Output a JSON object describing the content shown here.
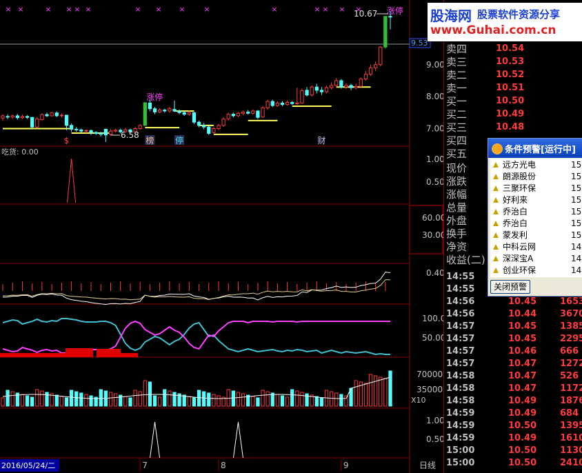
{
  "chart": {
    "candles": [
      {
        "o": 7.33,
        "c": 7.4,
        "h": 7.45,
        "l": 7.25
      },
      {
        "o": 7.38,
        "c": 7.36,
        "h": 7.45,
        "l": 7.3
      },
      {
        "o": 7.36,
        "c": 7.4,
        "h": 7.44,
        "l": 7.3
      },
      {
        "o": 7.4,
        "c": 7.34,
        "h": 7.46,
        "l": 7.28
      },
      {
        "o": 7.34,
        "c": 7.38,
        "h": 7.44,
        "l": 7.3
      },
      {
        "o": 7.38,
        "c": 7.35,
        "h": 7.42,
        "l": 7.3
      },
      {
        "o": 7.35,
        "c": 7.05,
        "h": 7.36,
        "l": 7.0
      },
      {
        "o": 7.05,
        "c": 7.3,
        "h": 7.36,
        "l": 7.02
      },
      {
        "o": 7.28,
        "c": 7.44,
        "h": 7.48,
        "l": 7.26
      },
      {
        "o": 7.44,
        "c": 7.4,
        "h": 7.5,
        "l": 7.36
      },
      {
        "o": 7.4,
        "c": 7.49,
        "h": 7.53,
        "l": 7.38
      },
      {
        "o": 7.49,
        "c": 7.4,
        "h": 7.54,
        "l": 7.36
      },
      {
        "o": 7.4,
        "c": 7.42,
        "h": 7.48,
        "l": 7.34
      },
      {
        "o": 7.42,
        "c": 7.1,
        "h": 7.43,
        "l": 6.95
      },
      {
        "o": 7.1,
        "c": 6.98,
        "h": 7.16,
        "l": 6.9
      },
      {
        "o": 6.98,
        "c": 6.96,
        "h": 7.05,
        "l": 6.9
      },
      {
        "o": 6.96,
        "c": 6.92,
        "h": 7.0,
        "l": 6.86
      },
      {
        "o": 6.92,
        "c": 6.94,
        "h": 6.98,
        "l": 6.86
      },
      {
        "o": 6.94,
        "c": 6.88,
        "h": 6.97,
        "l": 6.8
      },
      {
        "o": 6.88,
        "c": 6.85,
        "h": 6.92,
        "l": 6.8
      },
      {
        "o": 6.86,
        "c": 6.82,
        "h": 6.9,
        "l": 6.75
      },
      {
        "o": 6.98,
        "c": 6.8,
        "h": 7.0,
        "l": 6.58
      },
      {
        "o": 6.82,
        "c": 6.92,
        "h": 6.98,
        "l": 6.78
      },
      {
        "o": 6.92,
        "c": 6.95,
        "h": 7.0,
        "l": 6.88
      },
      {
        "o": 6.95,
        "c": 6.9,
        "h": 7.0,
        "l": 6.85
      },
      {
        "o": 6.9,
        "c": 6.96,
        "h": 7.02,
        "l": 6.88
      },
      {
        "o": 6.96,
        "c": 6.9,
        "h": 7.0,
        "l": 6.86
      },
      {
        "o": 6.9,
        "c": 7.0,
        "h": 7.06,
        "l": 6.88
      },
      {
        "o": 7.0,
        "c": 7.1,
        "h": 7.14,
        "l": 6.96
      },
      {
        "o": 7.1,
        "c": 7.81,
        "h": 7.81,
        "l": 7.08
      },
      {
        "o": 7.8,
        "c": 7.62,
        "h": 7.9,
        "l": 7.55
      },
      {
        "o": 7.62,
        "c": 7.52,
        "h": 7.68,
        "l": 7.45
      },
      {
        "o": 7.52,
        "c": 7.58,
        "h": 7.64,
        "l": 7.48
      },
      {
        "o": 7.58,
        "c": 7.55,
        "h": 7.62,
        "l": 7.5
      },
      {
        "o": 7.55,
        "c": 7.62,
        "h": 7.68,
        "l": 7.5
      },
      {
        "o": 7.6,
        "c": 7.55,
        "h": 7.88,
        "l": 7.52
      },
      {
        "o": 7.55,
        "c": 7.5,
        "h": 7.6,
        "l": 7.45
      },
      {
        "o": 7.5,
        "c": 7.45,
        "h": 7.56,
        "l": 7.4
      },
      {
        "o": 7.45,
        "c": 7.5,
        "h": 7.56,
        "l": 7.4
      },
      {
        "o": 7.5,
        "c": 7.2,
        "h": 7.52,
        "l": 7.14
      },
      {
        "o": 7.2,
        "c": 7.1,
        "h": 7.25,
        "l": 7.04
      },
      {
        "o": 7.1,
        "c": 7.05,
        "h": 7.18,
        "l": 6.98
      },
      {
        "o": 7.05,
        "c": 6.85,
        "h": 7.08,
        "l": 6.8
      },
      {
        "o": 6.88,
        "c": 7.0,
        "h": 7.05,
        "l": 6.84
      },
      {
        "o": 7.0,
        "c": 7.1,
        "h": 7.15,
        "l": 6.95
      },
      {
        "o": 7.1,
        "c": 7.3,
        "h": 7.35,
        "l": 7.05
      },
      {
        "o": 7.3,
        "c": 7.45,
        "h": 7.5,
        "l": 7.25
      },
      {
        "o": 7.45,
        "c": 7.4,
        "h": 7.5,
        "l": 7.35
      },
      {
        "o": 7.4,
        "c": 7.48,
        "h": 7.52,
        "l": 7.36
      },
      {
        "o": 7.48,
        "c": 7.52,
        "h": 7.56,
        "l": 7.42
      },
      {
        "o": 7.52,
        "c": 7.48,
        "h": 7.58,
        "l": 7.44
      },
      {
        "o": 7.48,
        "c": 7.55,
        "h": 7.6,
        "l": 7.44
      },
      {
        "o": 7.55,
        "c": 7.35,
        "h": 7.58,
        "l": 7.3
      },
      {
        "o": 7.36,
        "c": 7.65,
        "h": 7.7,
        "l": 7.34
      },
      {
        "o": 7.65,
        "c": 7.85,
        "h": 7.9,
        "l": 7.6
      },
      {
        "o": 7.85,
        "c": 7.72,
        "h": 7.9,
        "l": 7.68
      },
      {
        "o": 7.72,
        "c": 7.8,
        "h": 7.86,
        "l": 7.68
      },
      {
        "o": 7.8,
        "c": 7.75,
        "h": 7.86,
        "l": 7.7
      },
      {
        "o": 7.75,
        "c": 7.82,
        "h": 7.88,
        "l": 7.72
      },
      {
        "o": 7.82,
        "c": 7.78,
        "h": 7.86,
        "l": 7.74
      },
      {
        "o": 7.78,
        "c": 7.8,
        "h": 8.28,
        "l": 7.74
      },
      {
        "o": 7.8,
        "c": 8.19,
        "h": 8.25,
        "l": 7.78
      },
      {
        "o": 8.2,
        "c": 8.05,
        "h": 8.3,
        "l": 8.0
      },
      {
        "o": 8.05,
        "c": 8.3,
        "h": 8.35,
        "l": 8.0
      },
      {
        "o": 8.3,
        "c": 8.2,
        "h": 8.4,
        "l": 8.1
      },
      {
        "o": 8.2,
        "c": 8.15,
        "h": 8.3,
        "l": 8.05
      },
      {
        "o": 8.15,
        "c": 8.28,
        "h": 8.35,
        "l": 8.1
      },
      {
        "o": 8.28,
        "c": 8.35,
        "h": 8.45,
        "l": 8.22
      },
      {
        "o": 8.35,
        "c": 8.5,
        "h": 8.58,
        "l": 8.3
      },
      {
        "o": 8.5,
        "c": 8.3,
        "h": 8.55,
        "l": 8.25
      },
      {
        "o": 8.3,
        "c": 8.35,
        "h": 8.42,
        "l": 8.24
      },
      {
        "o": 8.35,
        "c": 8.28,
        "h": 8.4,
        "l": 8.2
      },
      {
        "o": 8.28,
        "c": 8.32,
        "h": 8.4,
        "l": 8.22
      },
      {
        "o": 8.32,
        "c": 8.55,
        "h": 8.6,
        "l": 8.28
      },
      {
        "o": 8.55,
        "c": 8.7,
        "h": 8.8,
        "l": 8.5
      },
      {
        "o": 8.7,
        "c": 8.9,
        "h": 9.0,
        "l": 8.65
      },
      {
        "o": 8.9,
        "c": 9.0,
        "h": 9.1,
        "l": 8.8
      },
      {
        "o": 9.0,
        "c": 9.55,
        "h": 9.58,
        "l": 8.95
      },
      {
        "o": 9.55,
        "c": 10.51,
        "h": 10.51,
        "l": 9.5
      },
      {
        "o": 10.51,
        "c": 10.5,
        "h": 10.67,
        "l": 10.1
      }
    ],
    "price_axis": {
      "min": 6.45,
      "max": 10.85,
      "ticks": [
        "9.00",
        "8.00",
        "7.00"
      ],
      "current": "9.53"
    },
    "high_label": "10.67",
    "low_label": "6.58",
    "limit_up_label": "涨停",
    "marker_labels": [
      {
        "text": "$",
        "index": 13,
        "color": "#ff4040"
      },
      {
        "text": "榜",
        "index": 30,
        "color": "#e0c080"
      },
      {
        "text": "停",
        "index": 36,
        "color": "#40e0e0"
      },
      {
        "text": "财",
        "index": 65,
        "color": "#c0c0ff"
      }
    ],
    "panel2": {
      "title": "吃货: 0.00",
      "ticks": [
        "1.00",
        "0.50"
      ],
      "spikes": [
        14
      ]
    },
    "panel3": {
      "ticks": [
        "60.00",
        "30.00"
      ]
    },
    "panel4": {
      "ticks": [
        "0.40"
      ]
    },
    "panel5": {
      "ticks": [
        "100.0",
        "50.00"
      ]
    },
    "panel6": {
      "ticks": [
        "70000",
        "35000"
      ],
      "unit": "X10"
    },
    "panel7": {
      "ticks": [
        "1.00",
        "0.50"
      ],
      "spikes": [
        31,
        48
      ]
    },
    "date_axis": {
      "first": "2016/05/24/二",
      "labels": [
        {
          "text": "7",
          "index": 28
        },
        {
          "text": "8",
          "index": 44
        },
        {
          "text": "9",
          "index": 69
        }
      ],
      "period": "日线"
    },
    "colors": {
      "up": "#ff3b3b",
      "down": "#54fcfc",
      "limit": "#34c034",
      "bg": "#000000",
      "grid": "#8b0000",
      "pink": "#ff40ff",
      "cyan": "#40c0d0",
      "yellow": "#ffff60"
    }
  },
  "quote": {
    "orders": [
      {
        "label": "卖四",
        "price": "10.54"
      },
      {
        "label": "卖三",
        "price": "10.53"
      },
      {
        "label": "卖二",
        "price": "10.52"
      },
      {
        "label": "卖一",
        "price": "10.51"
      },
      {
        "label": "买一",
        "price": "10.50"
      },
      {
        "label": "买二",
        "price": "10.49"
      },
      {
        "label": "买三",
        "price": "10.48"
      },
      {
        "label": "买四",
        "price": ""
      },
      {
        "label": "买五",
        "price": ""
      }
    ],
    "fields": [
      "现价",
      "涨跌",
      "涨幅",
      "总量",
      "外盘",
      "换手",
      "净资",
      "收益(二)"
    ],
    "ticks": [
      {
        "time": "14:55",
        "price": "",
        "vol": ""
      },
      {
        "time": "14:55",
        "price": "",
        "vol": ""
      },
      {
        "time": "14:56",
        "price": "10.45",
        "vol": "1653"
      },
      {
        "time": "14:56",
        "price": "10.44",
        "vol": "3670"
      },
      {
        "time": "14:57",
        "price": "10.45",
        "vol": "1385"
      },
      {
        "time": "14:57",
        "price": "10.45",
        "vol": "2295"
      },
      {
        "time": "14:57",
        "price": "10.46",
        "vol": "666"
      },
      {
        "time": "14:57",
        "price": "10.47",
        "vol": "1272"
      },
      {
        "time": "14:58",
        "price": "10.47",
        "vol": "526"
      },
      {
        "time": "14:58",
        "price": "10.47",
        "vol": "1172"
      },
      {
        "time": "14:58",
        "price": "10.49",
        "vol": "1876"
      },
      {
        "time": "14:59",
        "price": "10.49",
        "vol": "684"
      },
      {
        "time": "14:59",
        "price": "10.50",
        "vol": "1395"
      },
      {
        "time": "14:59",
        "price": "10.49",
        "vol": "1610"
      },
      {
        "time": "15:00",
        "price": "10.50",
        "vol": "1130"
      },
      {
        "time": "15:00",
        "price": "10.50",
        "vol": "2410"
      }
    ]
  },
  "logo": {
    "brand": "股海网",
    "slogan": "股票软件资源分享",
    "url": "www.Guhai.com.cn"
  },
  "alert": {
    "title": "条件预警[运行中]",
    "items": [
      {
        "name": "远方光电",
        "time": "15:"
      },
      {
        "name": "朗源股份",
        "time": "15:"
      },
      {
        "name": "三聚环保",
        "time": "15:"
      },
      {
        "name": "好利来",
        "time": "15:"
      },
      {
        "name": "乔治白",
        "time": "15:"
      },
      {
        "name": "乔治白",
        "time": "15:"
      },
      {
        "name": "蒙发利",
        "time": "15:"
      },
      {
        "name": "中科云网",
        "time": "14:"
      },
      {
        "name": "深深宝A",
        "time": "14:"
      },
      {
        "name": "创业环保",
        "time": "14:"
      }
    ],
    "close_button": "关闭预警"
  }
}
